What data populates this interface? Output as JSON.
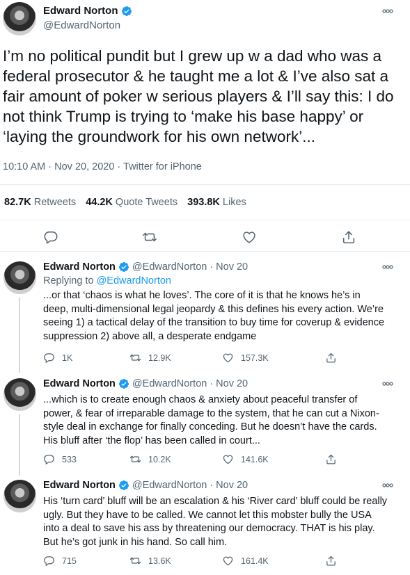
{
  "main_tweet": {
    "author_name": "Edward Norton",
    "author_handle": "@EdwardNorton",
    "text": "I’m no political pundit but I grew up w a dad who was a federal prosecutor & he taught me a lot & I’ve also sat a fair amount of poker w serious players & I’ll say this: I do not think Trump is trying to ‘make his base happy’ or ‘laying the groundwork for his own network’...",
    "meta": "10:10 AM · Nov 20, 2020 · Twitter for iPhone",
    "stats": [
      {
        "value": "82.7K",
        "label": "Retweets"
      },
      {
        "value": "44.2K",
        "label": "Quote Tweets"
      },
      {
        "value": "393.8K",
        "label": "Likes"
      }
    ]
  },
  "replies": [
    {
      "author_name": "Edward Norton",
      "author_handle": "@EdwardNorton",
      "separator": "·",
      "date": "Nov 20",
      "replying_prefix": "Replying to",
      "replying_to": "@EdwardNorton",
      "text": "...or that ‘chaos is what he loves’. The core of it is that he knows he’s in deep, multi-dimensional legal jeopardy & this defines his every action. We’re seeing 1) a tactical delay of the transition to buy time for coverup & evidence suppression 2) above all, a desperate endgame",
      "reply_count": "1K",
      "retweet_count": "12.9K",
      "like_count": "157.3K"
    },
    {
      "author_name": "Edward Norton",
      "author_handle": "@EdwardNorton",
      "separator": "·",
      "date": "Nov 20",
      "text": "...which is to create enough chaos & anxiety about peaceful transfer of power, & fear of irreparable damage to the system, that he can cut a Nixon-style deal in exchange for finally conceding. But he doesn’t have the cards. His bluff after ‘the flop’ has been called in court...",
      "reply_count": "533",
      "retweet_count": "10.2K",
      "like_count": "141.6K"
    },
    {
      "author_name": "Edward Norton",
      "author_handle": "@EdwardNorton",
      "separator": "·",
      "date": "Nov 20",
      "text": "His ‘turn card’ bluff will be an escalation & his ‘River card’ bluff could be really ugly. But they have to be called. We cannot let this mobster bully the USA into a deal to save his ass by threatening our democracy. THAT is his play. But he’s got junk in his hand. So call him.",
      "reply_count": "715",
      "retweet_count": "13.6K",
      "like_count": "161.4K"
    }
  ],
  "icons": {
    "verified": "verified-badge-icon",
    "more": "more-options-icon",
    "reply": "reply-icon",
    "retweet": "retweet-icon",
    "like": "heart-icon",
    "share": "share-icon"
  },
  "colors": {
    "accent": "#1d9bf0",
    "secondary_text": "#536471",
    "primary_text": "#0f1419",
    "divider": "#e6ecf0"
  }
}
